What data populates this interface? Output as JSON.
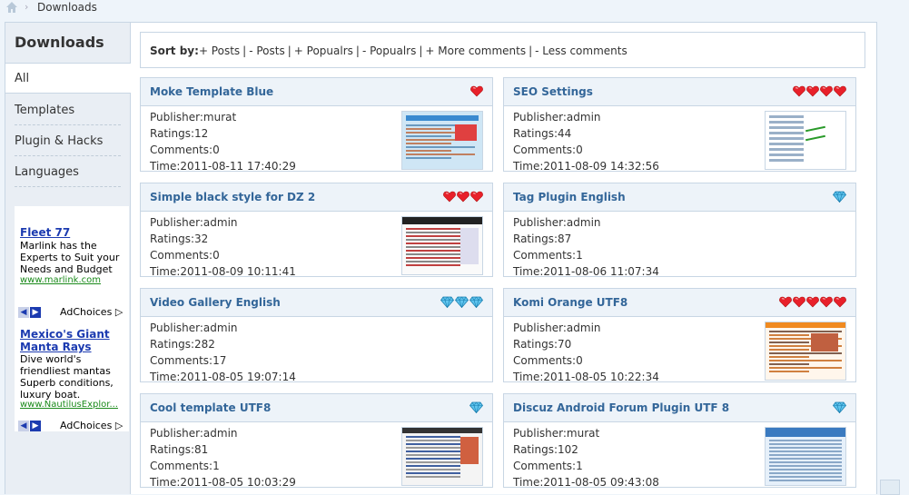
{
  "breadcrumb": {
    "home_icon": "home-icon",
    "current": "Downloads"
  },
  "sidebar": {
    "title": "Downloads",
    "items": [
      {
        "label": "All",
        "active": true
      },
      {
        "label": "Templates"
      },
      {
        "label": "Plugin & Hacks"
      },
      {
        "label": "Languages"
      }
    ]
  },
  "ads": [
    {
      "title": "Fleet 77",
      "body": "Marlink has the Experts to Suit your Needs and Budget",
      "url": "www.marlink.com",
      "choices": "AdChoices"
    },
    {
      "title": "Mexico's Giant Manta Rays",
      "body": "Dive world's friendliest mantas Superb conditions, luxury boat.",
      "url": "www.NautilusExplor...",
      "choices": "AdChoices"
    }
  ],
  "sort": {
    "label": "Sort by:",
    "options": [
      "+ Posts",
      "- Posts",
      "+ Popualrs",
      "- Popualrs",
      "+ More comments",
      "- Less comments"
    ]
  },
  "cards": [
    {
      "title": "Moke Template Blue",
      "publisher": "Publisher:murat",
      "ratings": "Ratings:12",
      "comments": "Comments:0",
      "time": "Time:2011-08-11 17:40:29",
      "rating_icon": "heart",
      "rating_count": 1,
      "thumb": "blue"
    },
    {
      "title": "SEO Settings",
      "publisher": "Publisher:admin",
      "ratings": "Ratings:44",
      "comments": "Comments:0",
      "time": "Time:2011-08-09 14:32:56",
      "rating_icon": "heart",
      "rating_count": 4,
      "thumb": "seo"
    },
    {
      "title": "Simple black style for DZ 2",
      "publisher": "Publisher:admin",
      "ratings": "Ratings:32",
      "comments": "Comments:0",
      "time": "Time:2011-08-09 10:11:41",
      "rating_icon": "heart",
      "rating_count": 3,
      "thumb": "black"
    },
    {
      "title": "Tag Plugin English",
      "publisher": "Publisher:admin",
      "ratings": "Ratings:87",
      "comments": "Comments:1",
      "time": "Time:2011-08-06 11:07:34",
      "rating_icon": "gem",
      "rating_count": 1,
      "thumb": "none"
    },
    {
      "title": "Video Gallery English",
      "publisher": "Publisher:admin",
      "ratings": "Ratings:282",
      "comments": "Comments:17",
      "time": "Time:2011-08-05 19:07:14",
      "rating_icon": "gem",
      "rating_count": 3,
      "thumb": "none"
    },
    {
      "title": "Komi Orange UTF8",
      "publisher": "Publisher:admin",
      "ratings": "Ratings:70",
      "comments": "Comments:0",
      "time": "Time:2011-08-05 10:22:34",
      "rating_icon": "heart",
      "rating_count": 5,
      "thumb": "orange"
    },
    {
      "title": "Cool template UTF8",
      "publisher": "Publisher:admin",
      "ratings": "Ratings:81",
      "comments": "Comments:1",
      "time": "Time:2011-08-05 10:03:29",
      "rating_icon": "gem",
      "rating_count": 1,
      "thumb": "cool"
    },
    {
      "title": "Discuz Android Forum Plugin UTF 8",
      "publisher": "Publisher:murat",
      "ratings": "Ratings:102",
      "comments": "Comments:1",
      "time": "Time:2011-08-05 09:43:08",
      "rating_icon": "gem",
      "rating_count": 1,
      "thumb": "android"
    }
  ],
  "colors": {
    "title": "#336699",
    "heart": "#e8202a",
    "gem": "#2aa0d8",
    "border": "#c8d6e4"
  }
}
